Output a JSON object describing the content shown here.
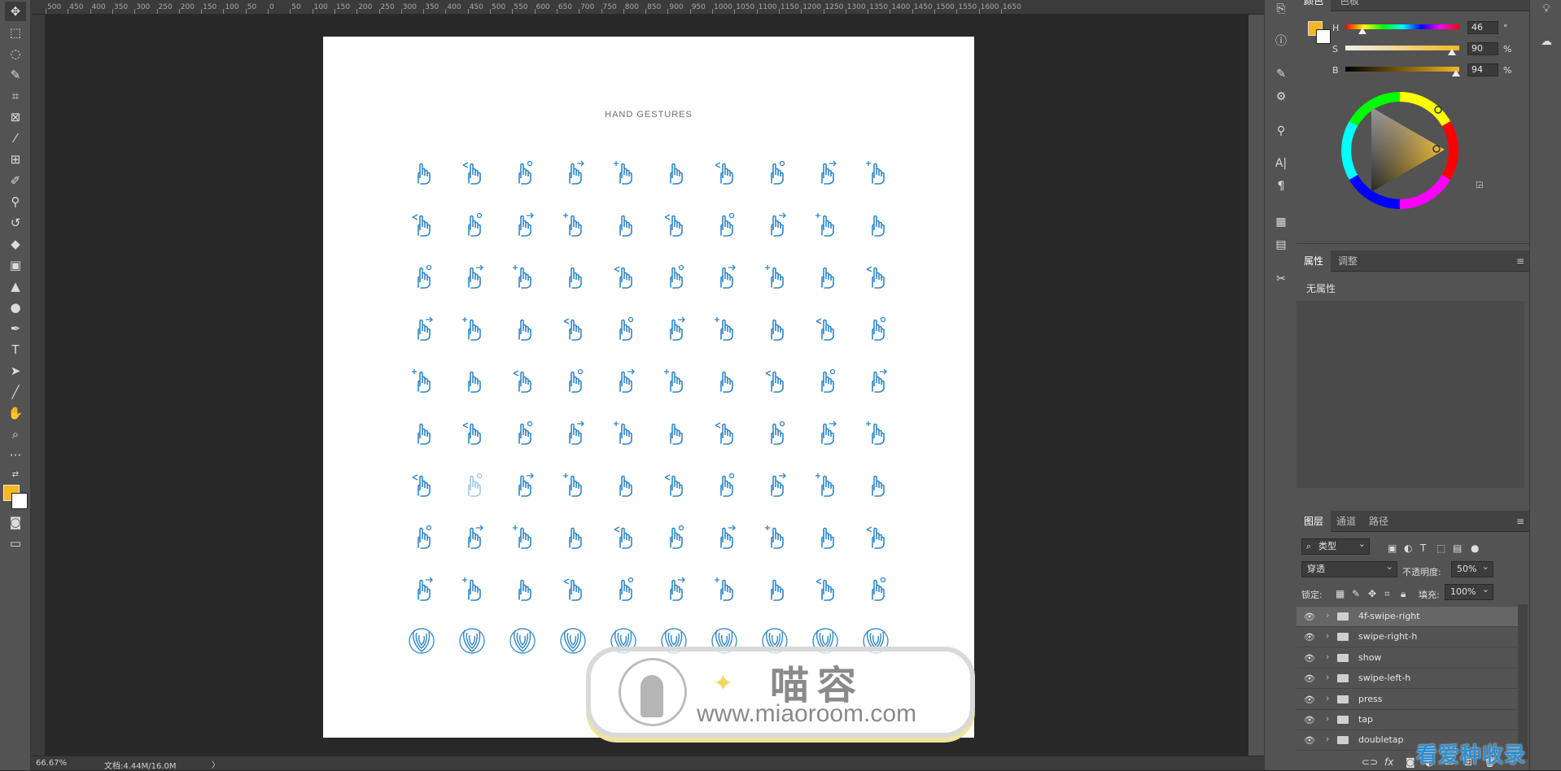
{
  "toolbar": {
    "tools": [
      "move-icon",
      "marquee-icon",
      "lasso-icon",
      "quick-select-icon",
      "crop-icon",
      "frame-icon",
      "eyedropper-icon",
      "spot-heal-icon",
      "brush-icon",
      "stamp-icon",
      "history-brush-icon",
      "eraser-icon",
      "gradient-icon",
      "blur-icon",
      "dodge-icon",
      "pen-icon",
      "type-icon",
      "path-select-icon",
      "line-icon",
      "hand-icon",
      "zoom-icon",
      "more-icon"
    ],
    "foreground_color": "#f4b71f",
    "background_color": "#ffffff"
  },
  "ruler": {
    "ticks": [
      "500",
      "450",
      "400",
      "350",
      "300",
      "250",
      "200",
      "150",
      "100",
      "50",
      "0",
      "50",
      "100",
      "150",
      "200",
      "250",
      "300",
      "350",
      "400",
      "450",
      "500",
      "550",
      "600",
      "650",
      "700",
      "750",
      "800",
      "850",
      "900",
      "950",
      "1000",
      "1050",
      "1100",
      "1150",
      "1200",
      "1250",
      "1300",
      "1350",
      "1400",
      "1450",
      "1500",
      "1550",
      "1600",
      "1650"
    ]
  },
  "document": {
    "title": "HAND GESTURES",
    "icon_color": "#2e86c9",
    "icon_rows": 10,
    "icon_cols": 10
  },
  "watermark": {
    "cn": "喵容",
    "url": "www.miaoroom.com"
  },
  "status": {
    "zoom": "66.67%",
    "doc": "文档:4.44M/16.0M",
    "arrow": "〉"
  },
  "color_panel": {
    "tabs": [
      "颜色",
      "色板"
    ],
    "h": {
      "label": "H",
      "value": "46",
      "unit": "°"
    },
    "s": {
      "label": "S",
      "value": "90",
      "unit": "%"
    },
    "b": {
      "label": "B",
      "value": "94",
      "unit": "%"
    }
  },
  "properties_panel": {
    "tabs": [
      "属性",
      "调整"
    ],
    "empty_text": "无属性"
  },
  "layers_panel": {
    "tabs": [
      "图层",
      "通道",
      "路径"
    ],
    "filter_label": "类型",
    "blend_mode": "穿透",
    "opacity_label": "不透明度:",
    "opacity_value": "50%",
    "lock_label": "锁定:",
    "fill_label": "填充:",
    "fill_value": "100%",
    "layers": [
      {
        "name": "4f-swipe-right",
        "selected": true
      },
      {
        "name": "swipe-right-h",
        "selected": false
      },
      {
        "name": "show",
        "selected": false
      },
      {
        "name": "swipe-left-h",
        "selected": false
      },
      {
        "name": "press",
        "selected": false
      },
      {
        "name": "tap",
        "selected": false
      },
      {
        "name": "doubletap",
        "selected": false
      }
    ],
    "footer_icons": [
      "link-icon",
      "fx-icon",
      "mask-icon",
      "adjustment-icon",
      "group-icon",
      "new-layer-icon",
      "trash-icon"
    ]
  },
  "bottom_watermark": "看爱种收录"
}
